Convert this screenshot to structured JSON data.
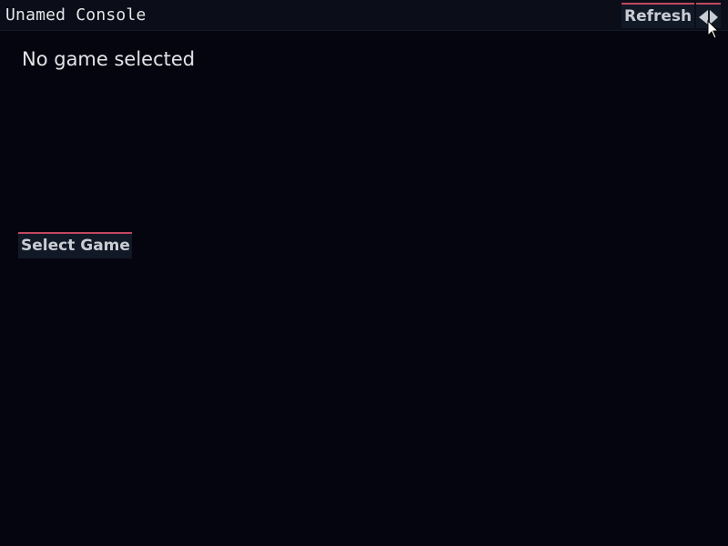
{
  "header": {
    "title": "Unamed Console",
    "refresh_label": "Refresh",
    "back_icon": "speaker-left-arrow-icon"
  },
  "main": {
    "status_text": "No game selected",
    "select_game_label": "Select Game"
  },
  "colors": {
    "background": "#050510",
    "topbar": "#0b0e19",
    "button_bg": "#111927",
    "button_accent": "#c2485f",
    "text": "#e4e4e8"
  }
}
